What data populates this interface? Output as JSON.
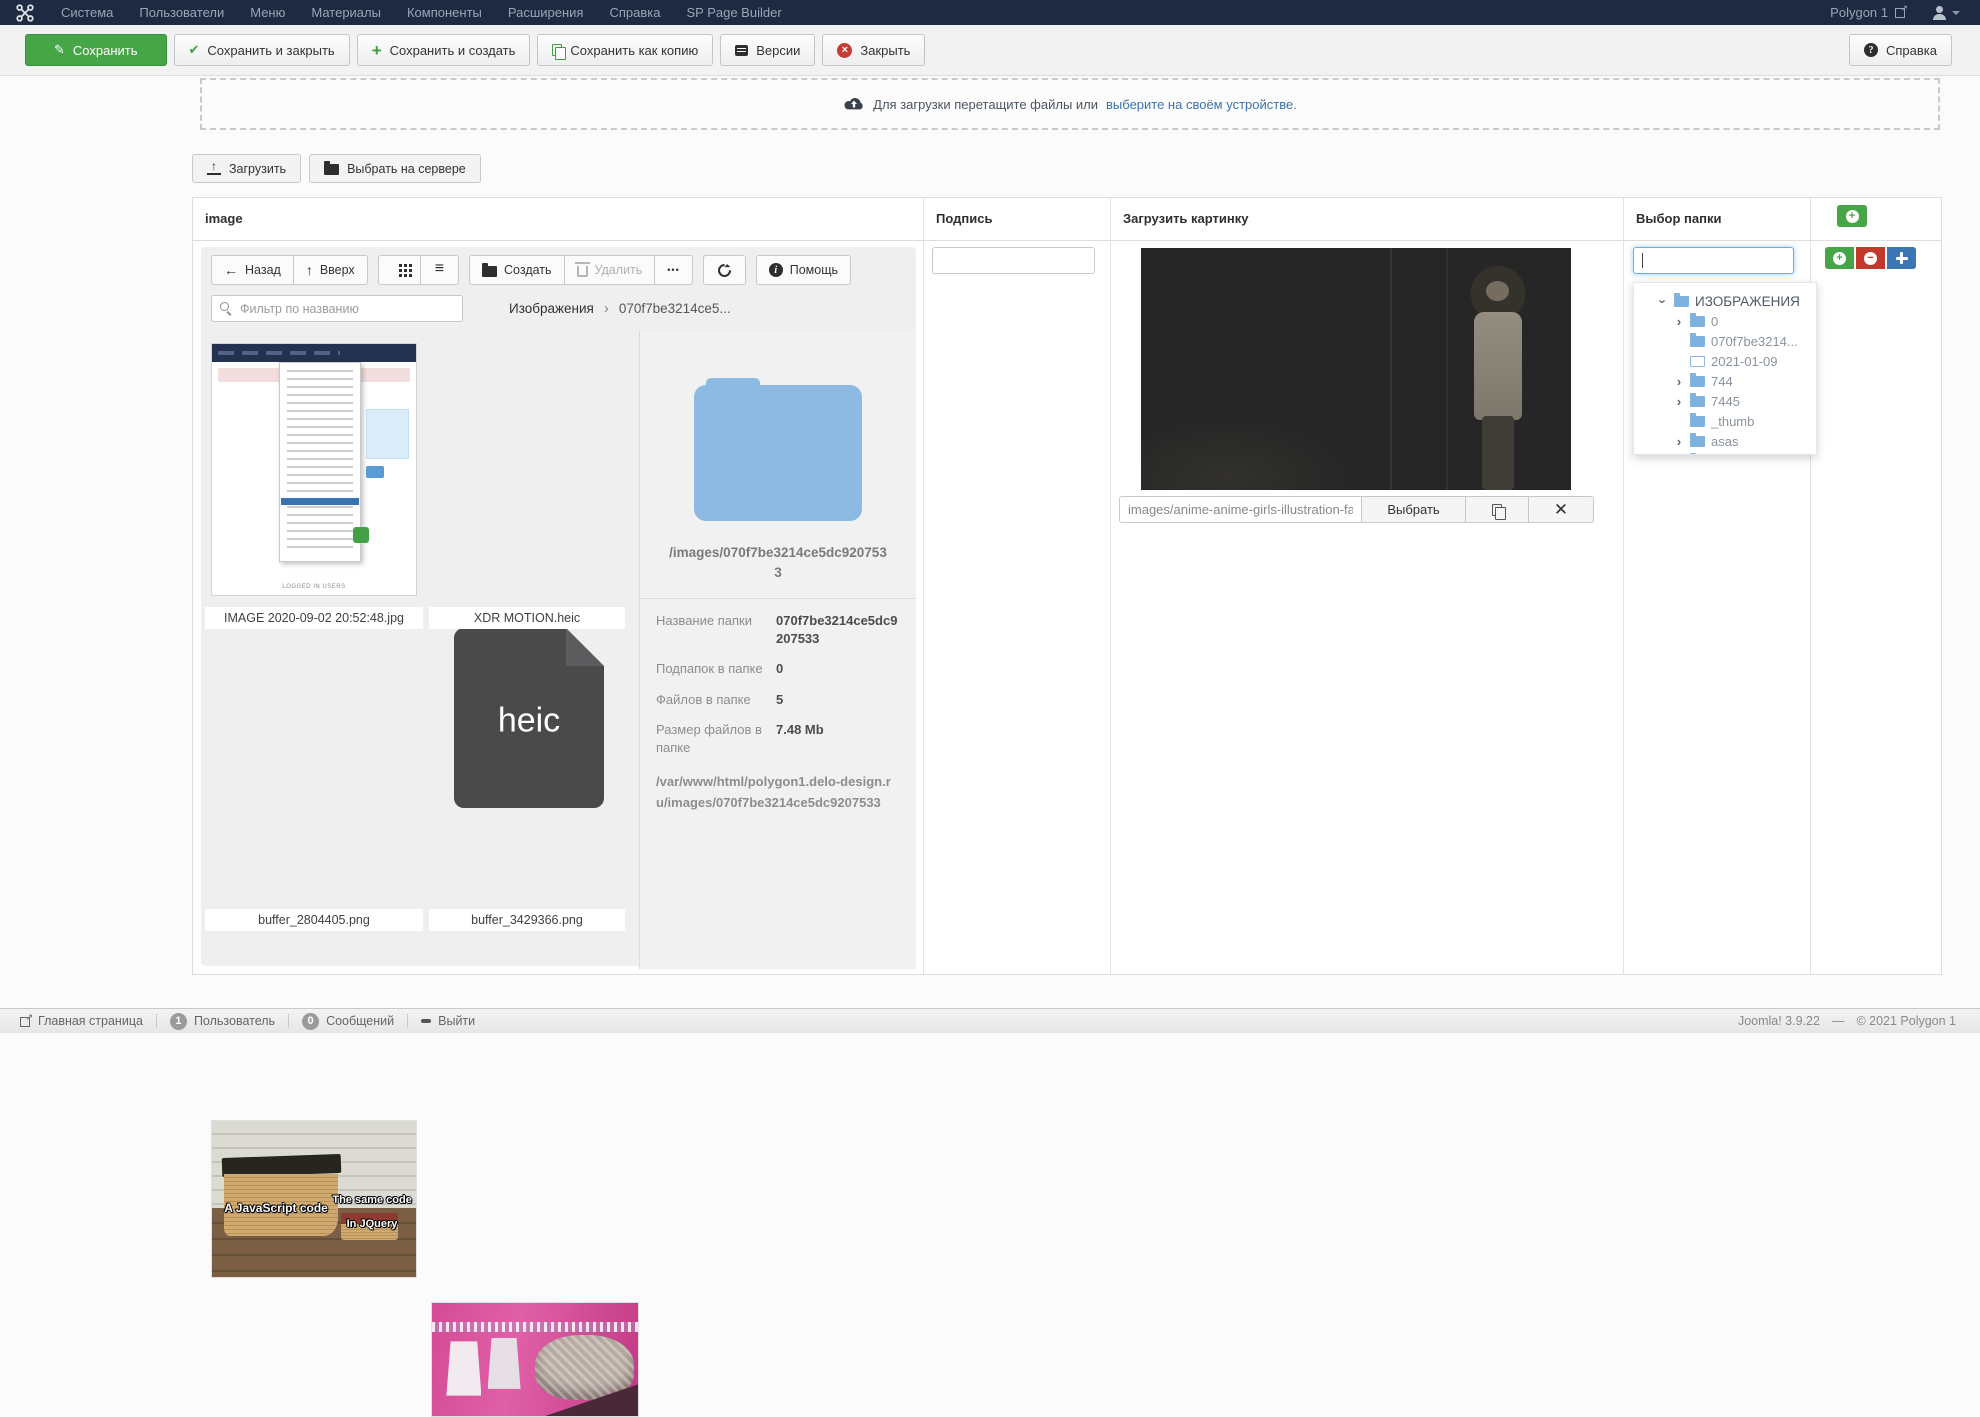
{
  "topnav": {
    "menus": [
      "Система",
      "Пользователи",
      "Меню",
      "Материалы",
      "Компоненты",
      "Расширения",
      "Справка",
      "SP Page Builder"
    ],
    "site_link": "Polygon 1"
  },
  "toolbar": {
    "save": "Сохранить",
    "save_close": "Сохранить и закрыть",
    "save_new": "Сохранить и создать",
    "save_copy": "Сохранить как копию",
    "versions": "Версии",
    "close": "Закрыть",
    "help": "Справка"
  },
  "dropzone": {
    "text": "Для загрузки перетащите файлы или",
    "link": "выберите на своём устройстве."
  },
  "actions": {
    "upload": "Загрузить",
    "select_server": "Выбрать на сервере"
  },
  "columns": {
    "image": "image",
    "caption": "Подпись",
    "upload_image": "Загрузить картинку",
    "folder_select": "Выбор папки"
  },
  "filemanager": {
    "toolbar": {
      "back": "Назад",
      "up": "Вверх",
      "create": "Создать",
      "delete": "Удалить",
      "more": "•••",
      "help": "Помощь"
    },
    "filter_placeholder": "Фильтр по названию",
    "breadcrumb": {
      "root": "Изображения",
      "separator": "›",
      "current": "070f7be3214ce5..."
    },
    "files": [
      {
        "name": "IMAGE 2020-09-02 20:52:48.jpg"
      },
      {
        "name": "XDR MOTION.heic",
        "badge": "heic"
      },
      {
        "name": "buffer_2804405.png"
      },
      {
        "name": "buffer_3429366.png"
      }
    ],
    "screenshot": {
      "footer": "LOGGED IN USERS"
    },
    "meme": {
      "left": "A JavaScript code",
      "right_top": "The same code",
      "right_bottom": "In JQuery"
    },
    "details": {
      "path": "/images/070f7be3214ce5dc9207533",
      "rows": [
        {
          "label": "Название папки",
          "value": "070f7be3214ce5dc9207533"
        },
        {
          "label": "Подпапок в папке",
          "value": "0"
        },
        {
          "label": "Файлов в папке",
          "value": "5"
        },
        {
          "label": "Размер файлов в папке",
          "value": "7.48 Mb"
        }
      ],
      "full_path": "/var/www/html/polygon1.delo-design.ru/images/070f7be3214ce5dc9207533"
    }
  },
  "image_field": {
    "value": "images/anime-anime-girls-illustration-fan",
    "select": "Выбрать"
  },
  "folder_tree": {
    "root": "ИЗОБРАЖЕНИЯ",
    "items": [
      "0",
      "070f7be3214...",
      "2021-01-09",
      "744",
      "7445",
      "_thumb",
      "asas"
    ]
  },
  "statusbar": {
    "home": "Главная страница",
    "users_count": "1",
    "users_label": "Пользователь",
    "messages_count": "0",
    "messages_label": "Сообщений",
    "logout": "Выйти",
    "version": "Joomla! 3.9.22",
    "dash": "—",
    "copyright": "© 2021 Polygon 1"
  }
}
